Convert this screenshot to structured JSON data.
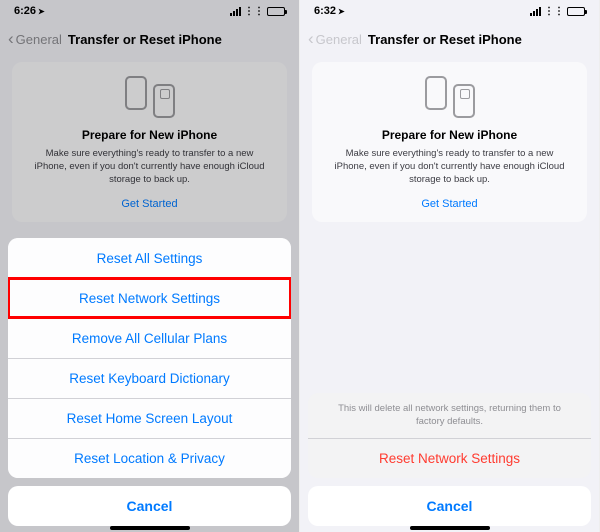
{
  "left": {
    "status": {
      "time": "6:26",
      "loc_icon": "➤"
    },
    "nav": {
      "back": "General",
      "title": "Transfer or Reset iPhone"
    },
    "card": {
      "title": "Prepare for New iPhone",
      "desc": "Make sure everything's ready to transfer to a new iPhone, even if you don't currently have enough iCloud storage to back up.",
      "link": "Get Started"
    },
    "sheet": {
      "items": [
        "Reset All Settings",
        "Reset Network Settings",
        "Remove All Cellular Plans",
        "Reset Keyboard Dictionary",
        "Reset Home Screen Layout",
        "Reset Location & Privacy"
      ],
      "cancel": "Cancel"
    }
  },
  "right": {
    "status": {
      "time": "6:32",
      "loc_icon": "➤"
    },
    "nav": {
      "back": "General",
      "title": "Transfer or Reset iPhone"
    },
    "card": {
      "title": "Prepare for New iPhone",
      "desc": "Make sure everything's ready to transfer to a new iPhone, even if you don't currently have enough iCloud storage to back up.",
      "link": "Get Started"
    },
    "confirm": {
      "message": "This will delete all network settings, returning them to factory defaults.",
      "action": "Reset Network Settings",
      "cancel": "Cancel"
    }
  },
  "colors": {
    "accent": "#007aff",
    "destructive": "#ff3b30"
  }
}
